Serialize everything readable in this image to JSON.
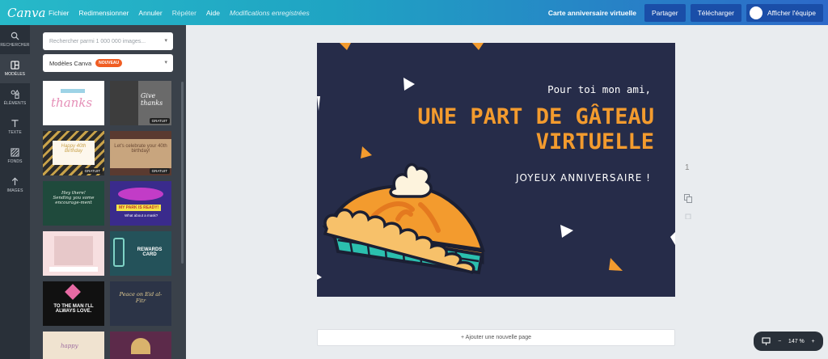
{
  "topbar": {
    "logo": "Canva",
    "menu": [
      "Fichier",
      "Redimensionner",
      "Annuler",
      "Répéter",
      "Aide"
    ],
    "saved_status": "Modifications enregistrées",
    "doc_title": "Carte anniversaire virtuelle",
    "share": "Partager",
    "download": "Télécharger",
    "team": "Afficher l'équipe"
  },
  "rail": [
    {
      "label": "RECHERCHER",
      "icon": "search-icon"
    },
    {
      "label": "MODÈLES",
      "icon": "templates-icon"
    },
    {
      "label": "ÉLÉMENTS",
      "icon": "elements-icon"
    },
    {
      "label": "TEXTE",
      "icon": "text-icon"
    },
    {
      "label": "FONDS",
      "icon": "backgrounds-icon"
    },
    {
      "label": "IMAGES",
      "icon": "upload-icon"
    }
  ],
  "panel": {
    "search_placeholder": "Rechercher parmi 1 000 000 images...",
    "dropdown": "Modèles Canva",
    "badge": "NOUVEAU",
    "free": "GRATUIT",
    "t1": "thanks",
    "t2": "Give thanks",
    "t3": "Happy 40th Birthday",
    "t4": "Let's celebrate your 40th birthday!",
    "t5": "Hey there! Sending you some encourage-ment",
    "t6": "MY PARK IS READY!",
    "t6b": "What about a mask?",
    "t8": "REWARDS CARD",
    "t9": "TO THE MAN I'LL ALWAYS LOVE.",
    "t10": "Peace on Eid al-Fitr",
    "t11": "happy"
  },
  "card": {
    "line1": "Pour toi mon ami,",
    "line2a": "UNE PART DE GÂTEAU",
    "line2b": "VIRTUELLE",
    "line3": "JOYEUX ANNIVERSAIRE !",
    "colors": {
      "bg": "#262c49",
      "accent": "#f39b2e",
      "teal": "#2bbfae"
    }
  },
  "page_number": "1",
  "add_page": "+ Ajouter une nouvelle page",
  "zoom": {
    "value": "147 %",
    "minus": "−",
    "plus": "+"
  }
}
